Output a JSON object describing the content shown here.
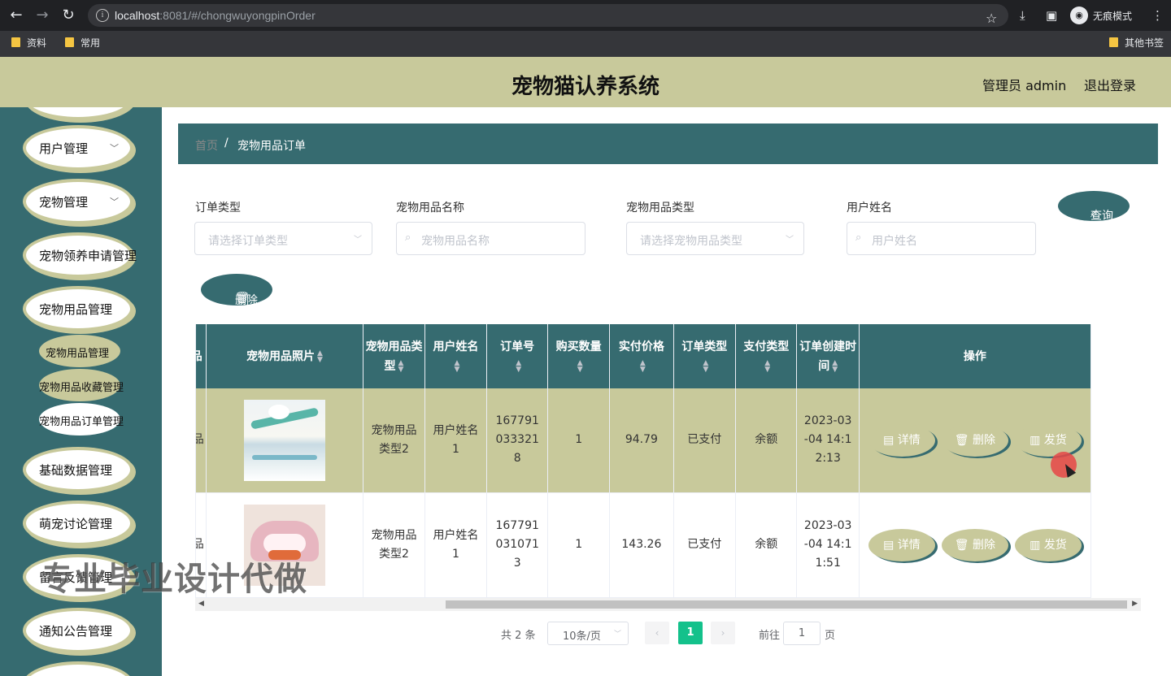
{
  "browser": {
    "url_host": "localhost",
    "url_rest": ":8081/#/chongwuyongpinOrder",
    "incognito_label": "无痕模式",
    "bookmarks": [
      "资料",
      "常用"
    ],
    "other_bookmarks": "其他书签"
  },
  "header": {
    "title": "宠物猫认养系统",
    "admin": "管理员 admin",
    "logout": "退出登录"
  },
  "sidebar": {
    "items": [
      "用户管理",
      "宠物管理",
      "宠物领养申请管理",
      "宠物用品管理",
      "基础数据管理",
      "萌宠讨论管理",
      "留言反馈管理",
      "通知公告管理"
    ],
    "sub_items": [
      "宠物用品管理",
      "宠物用品收藏管理",
      "宠物用品订单管理"
    ]
  },
  "breadcrumb": {
    "home": "首页",
    "sep": "/",
    "current": "宠物用品订单"
  },
  "filters": {
    "order_type_label": "订单类型",
    "order_type_placeholder": "请选择订单类型",
    "item_name_label": "宠物用品名称",
    "item_name_placeholder": "宠物用品名称",
    "item_type_label": "宠物用品类型",
    "item_type_placeholder": "请选择宠物用品类型",
    "user_name_label": "用户姓名",
    "user_name_placeholder": "用户姓名",
    "query_button": "查询"
  },
  "delete_button": "删除",
  "table": {
    "headers": {
      "cut": "品",
      "photo": "宠物用品照片",
      "type": "宠物用品类型",
      "user": "用户姓名",
      "order_no": "订单号",
      "qty": "购买数量",
      "price": "实付价格",
      "order_type": "订单类型",
      "pay_type": "支付类型",
      "created": "订单创建时间",
      "ops": "操作"
    },
    "rows": [
      {
        "cut": "品",
        "type": "宠物用品类型2",
        "user": "用户姓名1",
        "order_no": "1677910333218",
        "qty": "1",
        "price": "94.79",
        "order_type": "已支付",
        "pay_type": "余额",
        "created": "2023-03-04 14:12:13"
      },
      {
        "cut": "品",
        "type": "宠物用品类型2",
        "user": "用户姓名1",
        "order_no": "1677910310713",
        "qty": "1",
        "price": "143.26",
        "order_type": "已支付",
        "pay_type": "余额",
        "created": "2023-03-04 14:11:51"
      }
    ],
    "actions": {
      "detail": "详情",
      "delete": "删除",
      "ship": "发货"
    }
  },
  "pagination": {
    "total": "共 2 条",
    "page_size": "10条/页",
    "current_page": "1",
    "goto_label": "前往",
    "goto_value": "1",
    "page_unit": "页"
  },
  "watermark": "专业毕业设计代做"
}
